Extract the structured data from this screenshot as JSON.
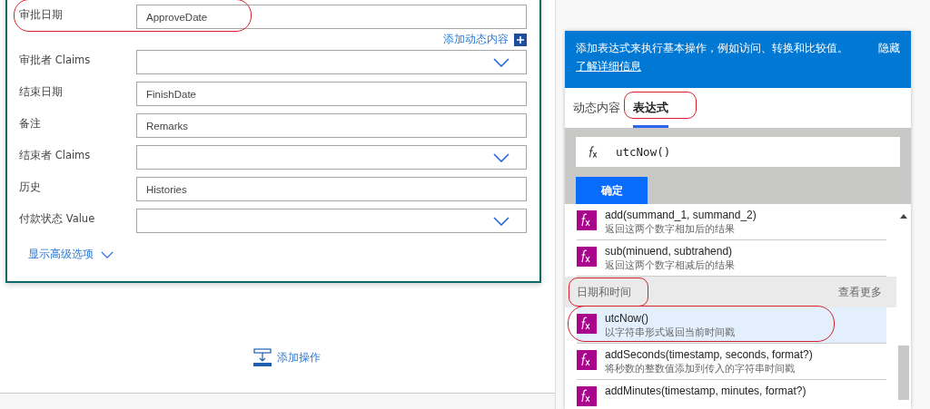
{
  "form": {
    "fields": [
      {
        "label": "审批日期",
        "kind": "text",
        "value": "ApproveDate"
      },
      {
        "label": "审批者 Claims",
        "kind": "dropdown"
      },
      {
        "label": "结束日期",
        "kind": "text",
        "value": "FinishDate"
      },
      {
        "label": "备注",
        "kind": "text",
        "value": "Remarks"
      },
      {
        "label": "结束者 Claims",
        "kind": "dropdown"
      },
      {
        "label": "历史",
        "kind": "text",
        "value": "Histories"
      },
      {
        "label": "付款状态 Value",
        "kind": "dropdown"
      }
    ],
    "dynamic_content_link": "添加动态内容",
    "advanced_options_link": "显示高级选项"
  },
  "add_action": "添加操作",
  "expression_panel": {
    "info": "添加表达式来执行基本操作，例如访问、转换和比较值。",
    "learn_more": "了解详细信息",
    "hide": "隐藏",
    "tabs": [
      {
        "label": "动态内容",
        "selected": false
      },
      {
        "label": "表达式",
        "selected": true
      }
    ],
    "expression": {
      "value": "utcNow()"
    },
    "ok_button": "确定",
    "list": [
      {
        "kind": "function",
        "name": "add(summand_1, summand_2)",
        "description": "返回这两个数字相加后的结果",
        "selected": false
      },
      {
        "kind": "function",
        "name": "sub(minuend, subtrahend)",
        "description": "返回这两个数字相减后的结果",
        "selected": false
      },
      {
        "kind": "section",
        "label": "日期和时间",
        "more": "查看更多"
      },
      {
        "kind": "function",
        "name": "utcNow()",
        "description": "以字符串形式返回当前时间戳",
        "selected": true
      },
      {
        "kind": "function",
        "name": "addSeconds(timestamp, seconds, format?)",
        "description": "将秒数的整数值添加到传入的字符串时间戳",
        "selected": false
      },
      {
        "kind": "function",
        "name": "addMinutes(timestamp, minutes, format?)",
        "selected": false
      }
    ]
  }
}
